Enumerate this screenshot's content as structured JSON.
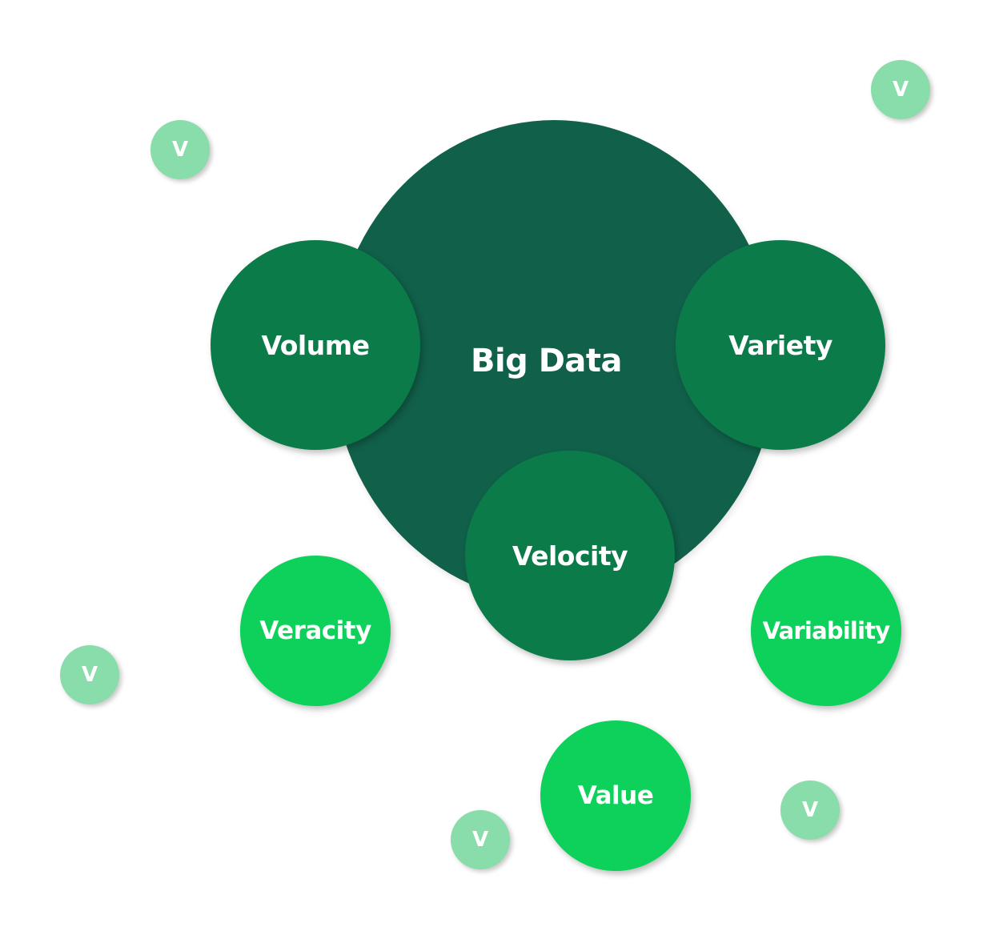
{
  "diagram": {
    "center": {
      "label": "Big Data"
    },
    "primary": [
      {
        "label": "Volume"
      },
      {
        "label": "Variety"
      },
      {
        "label": "Velocity"
      }
    ],
    "secondary": [
      {
        "label": "Veracity"
      },
      {
        "label": "Variability"
      },
      {
        "label": "Value"
      }
    ],
    "minor": [
      {
        "label": "V"
      },
      {
        "label": "V"
      },
      {
        "label": "V"
      },
      {
        "label": "V"
      },
      {
        "label": "V"
      }
    ]
  },
  "colors": {
    "center": "#11604a",
    "primary": "#0b7b4a",
    "secondary": "#0dd15a",
    "minor": "#88ddaa",
    "text": "#ffffff"
  }
}
